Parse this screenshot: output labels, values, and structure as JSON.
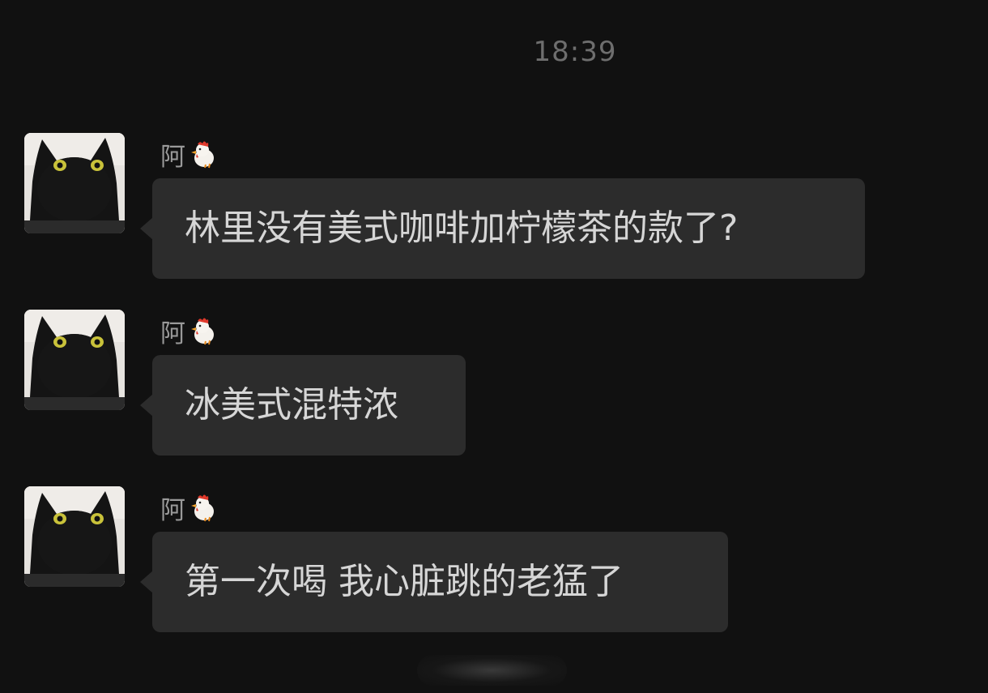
{
  "chat": {
    "timestamp": "18:39",
    "sender_emoji_icon": "rooster-emoji-icon",
    "messages": [
      {
        "sender": "阿",
        "text": "林里没有美式咖啡加柠檬茶的款了?"
      },
      {
        "sender": "阿",
        "text": "冰美式混特浓"
      },
      {
        "sender": "阿",
        "text": "第一次喝 我心脏跳的老猛了"
      }
    ]
  },
  "colors": {
    "background": "#111111",
    "bubble": "#2c2c2c",
    "text": "#d6d6d6",
    "timestamp": "#6e6e6e",
    "sender": "#9a9a9a"
  }
}
